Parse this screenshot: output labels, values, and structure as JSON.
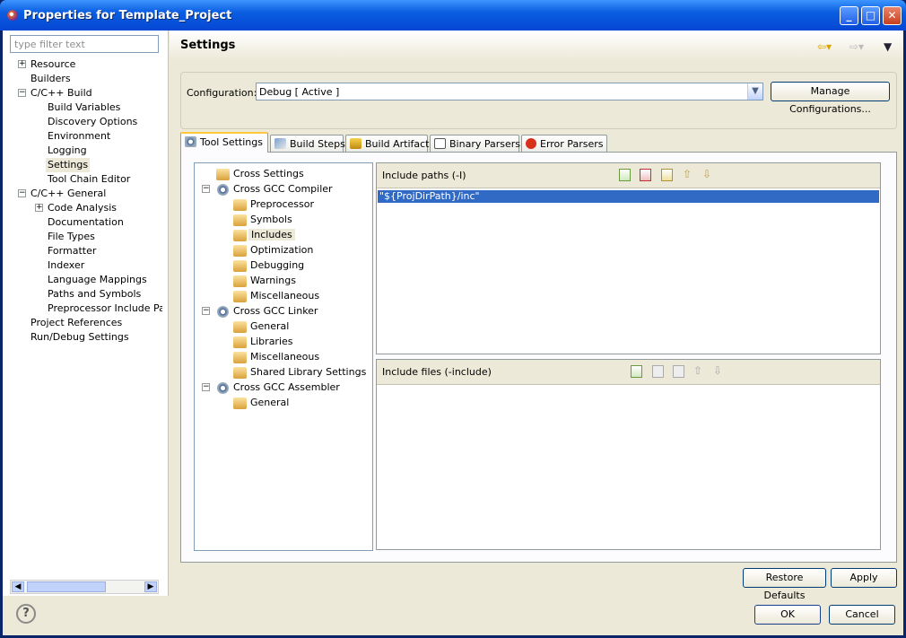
{
  "window": {
    "title": "Properties for Template_Project"
  },
  "filter": {
    "placeholder": "type filter text"
  },
  "nav_tree": [
    {
      "label": "Resource",
      "expander": "+"
    },
    {
      "label": "Builders"
    },
    {
      "label": "C/C++ Build",
      "expander": "-"
    },
    {
      "label": "Build Variables"
    },
    {
      "label": "Discovery Options"
    },
    {
      "label": "Environment"
    },
    {
      "label": "Logging"
    },
    {
      "label": "Settings"
    },
    {
      "label": "Tool Chain Editor"
    },
    {
      "label": "C/C++ General",
      "expander": "-"
    },
    {
      "label": "Code Analysis",
      "expander": "+"
    },
    {
      "label": "Documentation"
    },
    {
      "label": "File Types"
    },
    {
      "label": "Formatter"
    },
    {
      "label": "Indexer"
    },
    {
      "label": "Language Mappings"
    },
    {
      "label": "Paths and Symbols"
    },
    {
      "label": "Preprocessor Include Path"
    },
    {
      "label": "Project References"
    },
    {
      "label": "Run/Debug Settings"
    }
  ],
  "page": {
    "title": "Settings"
  },
  "config": {
    "label": "Configuration:",
    "value": "Debug  [ Active ]",
    "manage": "Manage Configurations..."
  },
  "tabs": [
    "Tool Settings",
    "Build Steps",
    "Build Artifact",
    "Binary Parsers",
    "Error Parsers"
  ],
  "tool_tree": [
    {
      "label": "Cross Settings"
    },
    {
      "label": "Cross GCC Compiler"
    },
    {
      "label": "Preprocessor"
    },
    {
      "label": "Symbols"
    },
    {
      "label": "Includes"
    },
    {
      "label": "Optimization"
    },
    {
      "label": "Debugging"
    },
    {
      "label": "Warnings"
    },
    {
      "label": "Miscellaneous"
    },
    {
      "label": "Cross GCC Linker"
    },
    {
      "label": "General"
    },
    {
      "label": "Libraries"
    },
    {
      "label": "Miscellaneous"
    },
    {
      "label": "Shared Library Settings"
    },
    {
      "label": "Cross GCC Assembler"
    },
    {
      "label": "General"
    }
  ],
  "include_paths": {
    "label": "Include paths (-I)",
    "items": [
      "\"${ProjDirPath}/inc\""
    ]
  },
  "include_files": {
    "label": "Include files (-include)"
  },
  "buttons": {
    "restore": "Restore Defaults",
    "apply": "Apply",
    "ok": "OK",
    "cancel": "Cancel"
  },
  "colors": {
    "selection": "#316ac5",
    "titlebar": "#0a5ee0"
  }
}
